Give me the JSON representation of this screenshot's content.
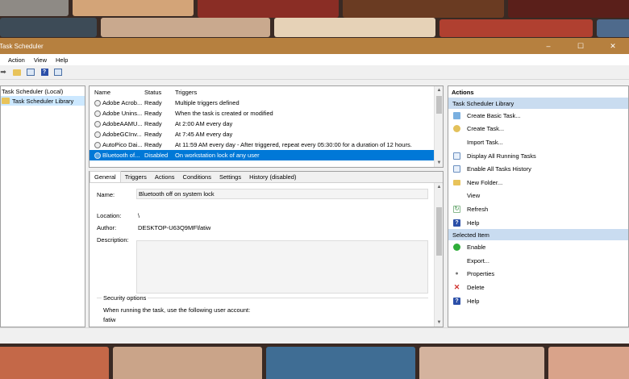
{
  "window": {
    "title": "Task Scheduler"
  },
  "window_controls": {
    "minimize": "–",
    "maximize": "☐",
    "close": "✕"
  },
  "menu": [
    "Action",
    "View",
    "Help"
  ],
  "tree": {
    "root": "Task Scheduler (Local)",
    "library": "Task Scheduler Library"
  },
  "task_list": {
    "headers": {
      "name": "Name",
      "status": "Status",
      "triggers": "Triggers"
    },
    "rows": [
      {
        "name": "Adobe Acrob...",
        "status": "Ready",
        "triggers": "Multiple triggers defined"
      },
      {
        "name": "Adobe Unins...",
        "status": "Ready",
        "triggers": "When the task is created or modified"
      },
      {
        "name": "AdobeAAMU...",
        "status": "Ready",
        "triggers": "At 2:00 AM every day"
      },
      {
        "name": "AdobeGCInv...",
        "status": "Ready",
        "triggers": "At 7:45 AM every day"
      },
      {
        "name": "AutoPico Dai...",
        "status": "Ready",
        "triggers": "At 11:59 AM every day - After triggered, repeat every 05:30:00 for a duration of 12 hours."
      },
      {
        "name": "Bluetooth of...",
        "status": "Disabled",
        "triggers": "On workstation lock of any user"
      }
    ]
  },
  "details": {
    "tabs": [
      "General",
      "Triggers",
      "Actions",
      "Conditions",
      "Settings",
      "History (disabled)"
    ],
    "name_label": "Name:",
    "name_value": "Bluetooth off on system lock",
    "location_label": "Location:",
    "location_value": "\\",
    "author_label": "Author:",
    "author_value": "DESKTOP-U63Q9MF\\fatiw",
    "description_label": "Description:",
    "security_title": "Security options",
    "security_text": "When running the task, use the following user account:",
    "security_user": "fatiw"
  },
  "actions_panel": {
    "header": "Actions",
    "library_section": "Task Scheduler Library",
    "library_items": [
      "Create Basic Task...",
      "Create Task...",
      "Import Task...",
      "Display All Running Tasks",
      "Enable All Tasks History",
      "New Folder...",
      "View",
      "Refresh",
      "Help"
    ],
    "selected_section": "Selected Item",
    "selected_items": [
      "Enable",
      "Export...",
      "Properties",
      "Delete",
      "Help"
    ]
  },
  "colors": {
    "titlebar": "#b6803f",
    "selection": "#0078d7",
    "section_header": "#c9dcf0"
  }
}
